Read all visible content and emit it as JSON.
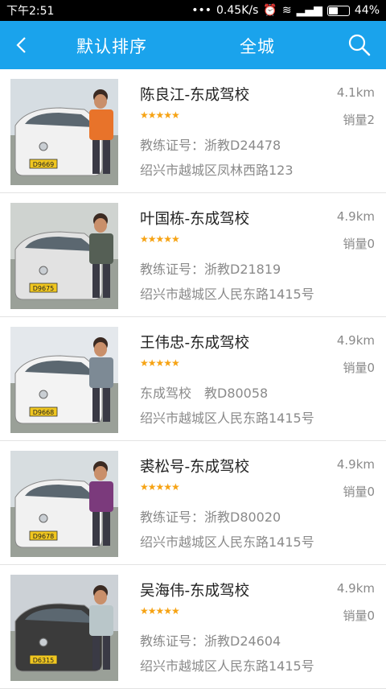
{
  "status": {
    "time": "下午2:51",
    "speed": "0.45K/s",
    "battery": "44%",
    "battery_level": 0.44
  },
  "header": {
    "sort_label": "默认排序",
    "city_label": "全城"
  },
  "icons": {
    "back": "back-arrow-icon",
    "search": "search-icon",
    "star": "star-icon"
  },
  "colors": {
    "header_bg": "#1aa3ec",
    "star": "#f6a314",
    "secondary_text": "#8a8a8a"
  },
  "coaches": [
    {
      "name": "陈良江-东成驾校",
      "stars": "★★★★★",
      "distance": "4.1km",
      "sales": "销量2",
      "cert": "教练证号：浙教D24478",
      "address": "绍兴市越城区凤林西路123",
      "plate": "D9669"
    },
    {
      "name": "叶国栋-东成驾校",
      "stars": "★★★★★",
      "distance": "4.9km",
      "sales": "销量0",
      "cert": "教练证号：浙教D21819",
      "address": "绍兴市越城区人民东路1415号",
      "plate": "D9675"
    },
    {
      "name": "王伟忠-东成驾校",
      "stars": "★★★★★",
      "distance": "4.9km",
      "sales": "销量0",
      "cert": "东成驾校　教D80058",
      "address": "绍兴市越城区人民东路1415号",
      "plate": "D9668"
    },
    {
      "name": "裘松号-东成驾校",
      "stars": "★★★★★",
      "distance": "4.9km",
      "sales": "销量0",
      "cert": "教练证号：浙教D80020",
      "address": "绍兴市越城区人民东路1415号",
      "plate": "D9678"
    },
    {
      "name": "吴海伟-东成驾校",
      "stars": "★★★★★",
      "distance": "4.9km",
      "sales": "销量0",
      "cert": "教练证号：浙教D24604",
      "address": "绍兴市越城区人民东路1415号",
      "plate": "D6315"
    }
  ]
}
